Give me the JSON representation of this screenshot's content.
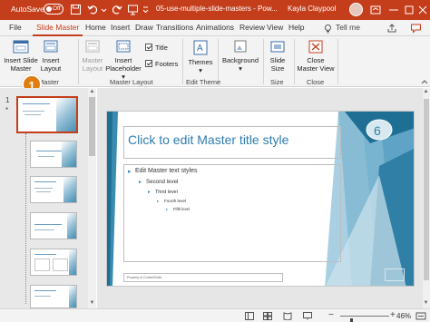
{
  "titlebar": {
    "autosave_label": "AutoSave",
    "autosave_state": "Off",
    "document_title": "05-use-multiple-slide-masters - Pow...",
    "user_name": "Kayla Claypool",
    "accent": "#c43e1c"
  },
  "tabs": [
    {
      "label": "File"
    },
    {
      "label": "Slide Master",
      "active": true
    },
    {
      "label": "Home"
    },
    {
      "label": "Insert"
    },
    {
      "label": "Draw"
    },
    {
      "label": "Transitions"
    },
    {
      "label": "Animations"
    },
    {
      "label": "Review"
    },
    {
      "label": "View"
    },
    {
      "label": "Help"
    }
  ],
  "tell_me": "Tell me",
  "ribbon": {
    "insert_slide_master": [
      "Insert Slide",
      "Master"
    ],
    "insert_layout": [
      "Insert",
      "Layout"
    ],
    "master_layout_btn": [
      "Master",
      "Layout"
    ],
    "insert_placeholder": [
      "Insert",
      "Placeholder"
    ],
    "title_checkbox": "Title",
    "footers_checkbox": "Footers",
    "themes": "Themes",
    "background": "Background",
    "slide_size": [
      "Slide",
      "Size"
    ],
    "close_master_view": [
      "Close",
      "Master View"
    ],
    "groups": {
      "edit_master": "dit Master",
      "master_layout": "Master Layout",
      "edit_theme": "Edit Theme",
      "size": "Size",
      "close": "Close"
    }
  },
  "step_badge": "1",
  "thumbnails": {
    "master_number": "1",
    "star": "*"
  },
  "slide": {
    "title_placeholder": "Click to edit Master title style",
    "body_levels": [
      "Edit Master text styles",
      "Second level",
      "Third level",
      "Fourth level",
      "Fifth level"
    ],
    "footer_placeholder": "Property of ContentSolid",
    "theme_color": "#2e7db0"
  },
  "status": {
    "zoom_percent": "46%",
    "zoom_level": 0.46
  }
}
